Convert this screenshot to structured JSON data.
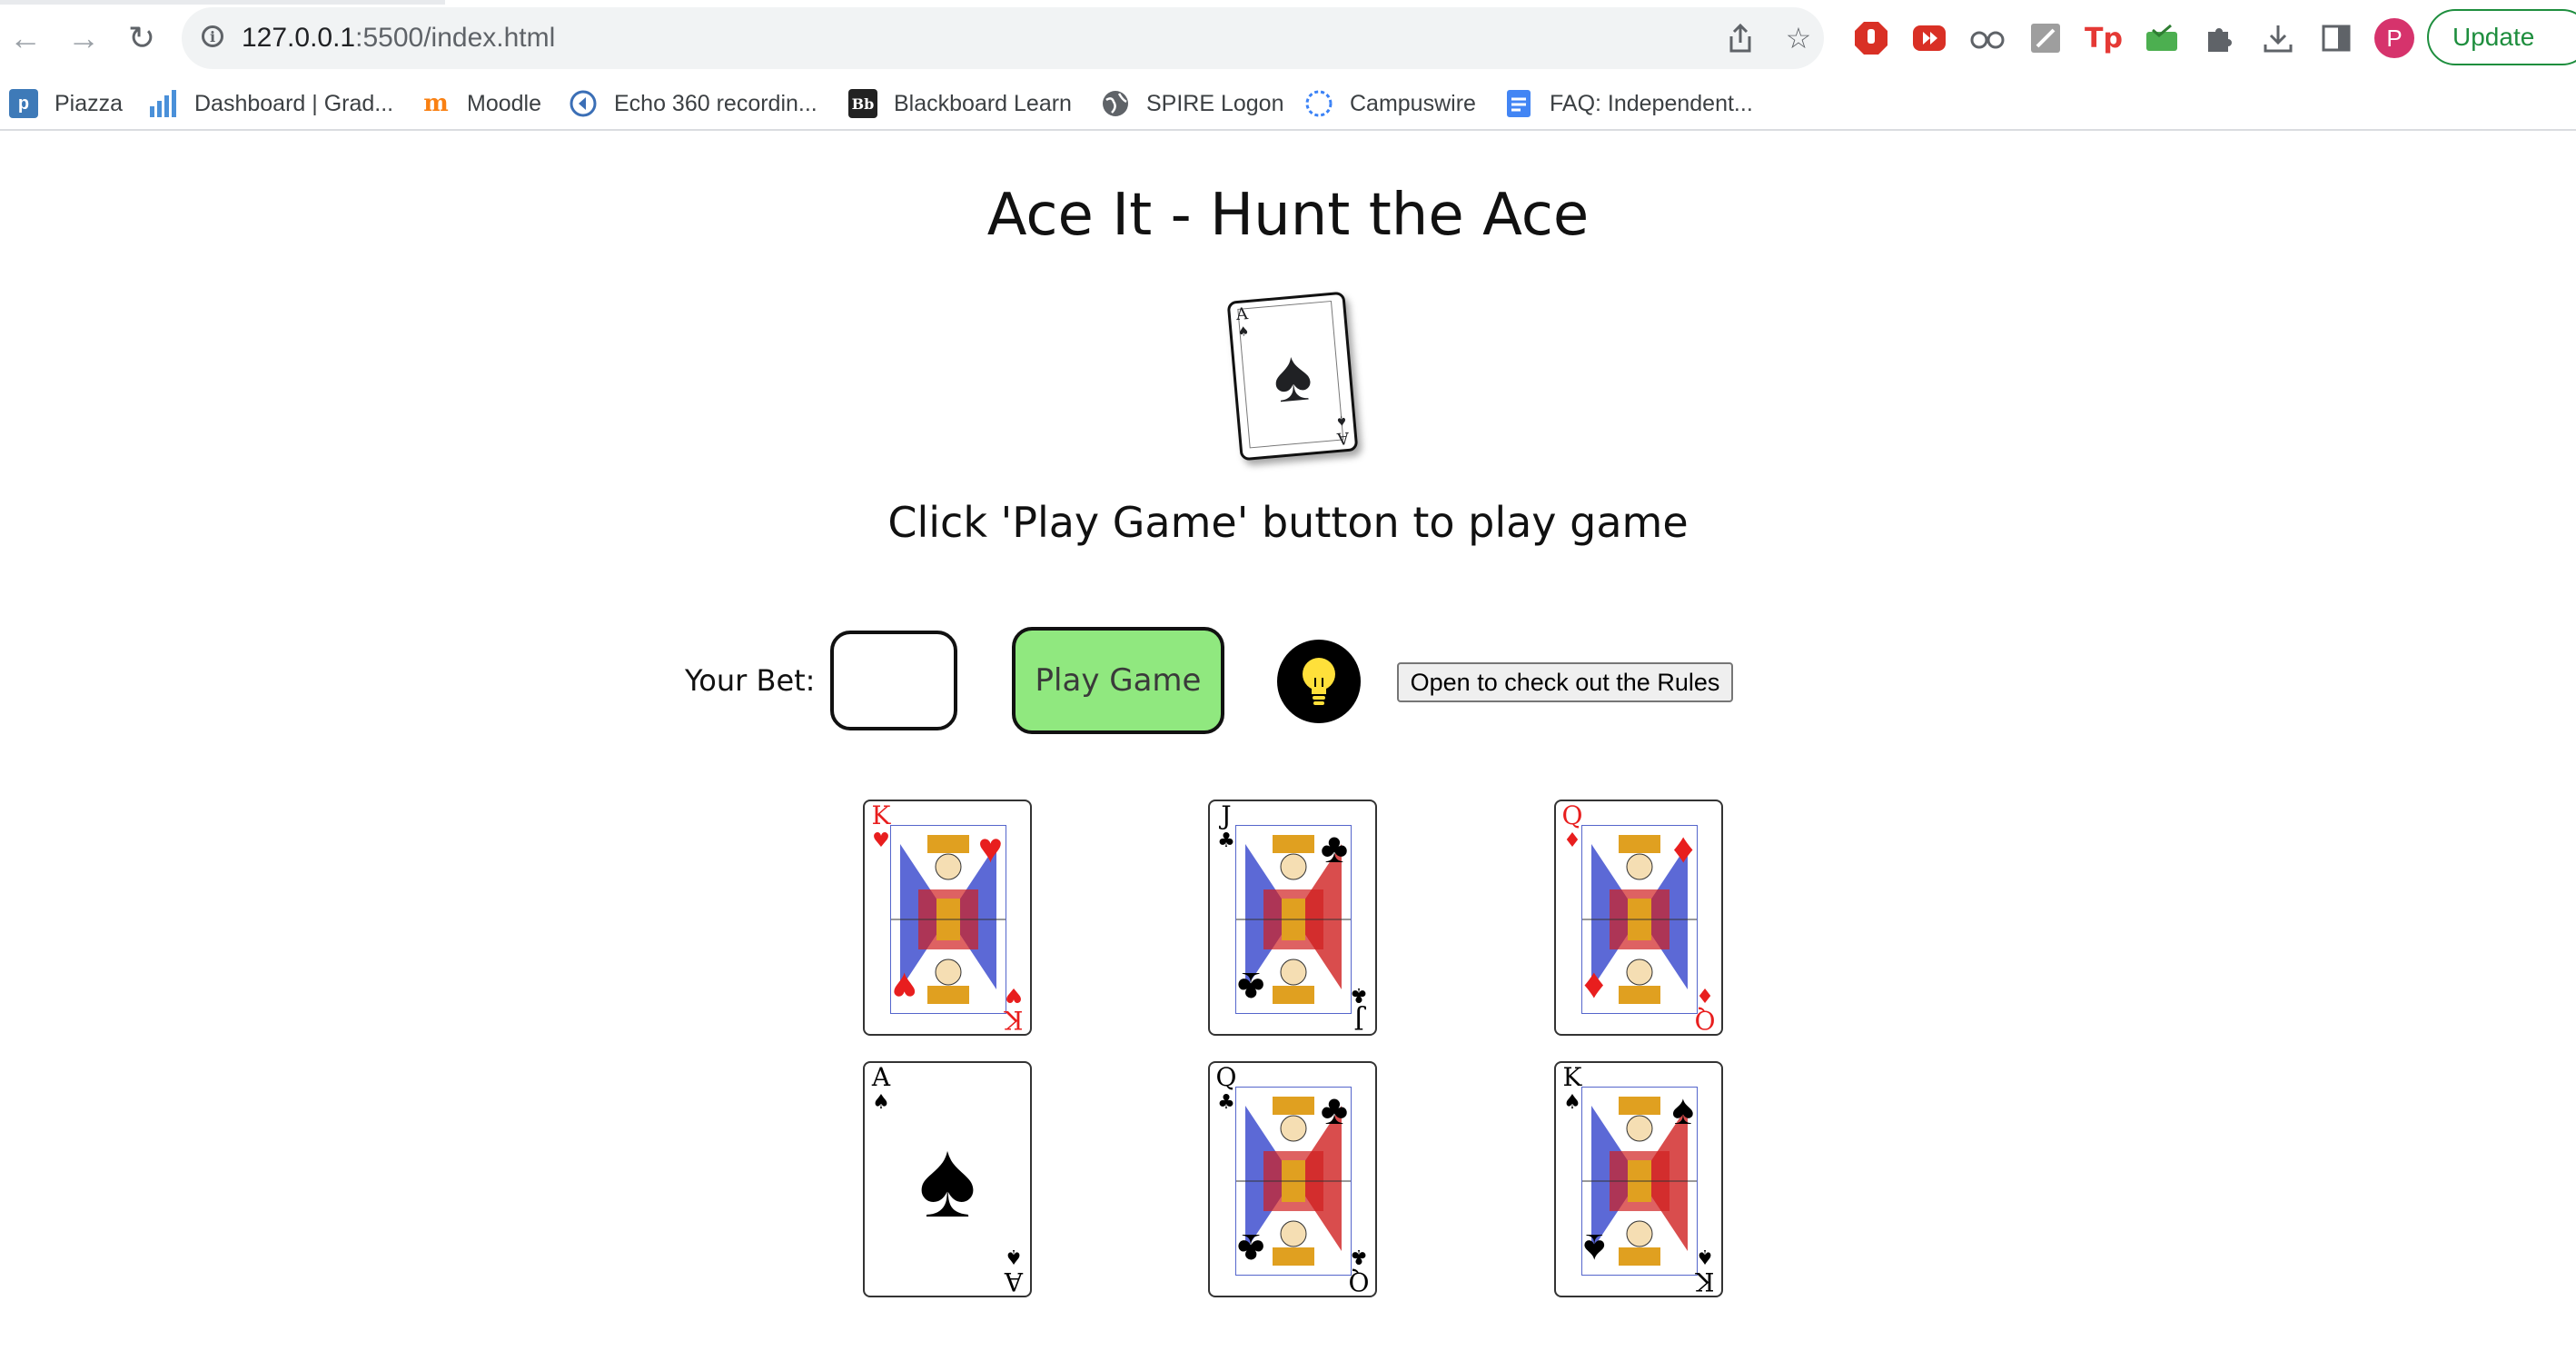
{
  "browser": {
    "url_host": "127.0.0.1",
    "url_path": ":5500/index.html",
    "update_label": "Update",
    "profile_initial": "P",
    "bookmarks": [
      {
        "label": "Piazza",
        "icon": "piazza-icon"
      },
      {
        "label": "Dashboard | Grad...",
        "icon": "bar-chart-icon"
      },
      {
        "label": "Moodle",
        "icon": "moodle-icon"
      },
      {
        "label": "Echo 360 recordin...",
        "icon": "echo360-icon"
      },
      {
        "label": "Blackboard Learn",
        "icon": "blackboard-icon"
      },
      {
        "label": "SPIRE Logon",
        "icon": "globe-icon"
      },
      {
        "label": "Campuswire",
        "icon": "campuswire-icon"
      },
      {
        "label": "FAQ: Independent...",
        "icon": "google-docs-icon"
      }
    ]
  },
  "game": {
    "title": "Ace It - Hunt the Ace",
    "instructions": "Click 'Play Game' button to play game",
    "bet_label": "Your Bet:",
    "bet_value": "",
    "play_label": "Play Game",
    "rules_label": "Open to check out the Rules",
    "hero_card": {
      "rank": "A",
      "suit": "♠"
    },
    "cards": [
      {
        "rank": "K",
        "suit": "♥",
        "color": "#e81e1e",
        "name": "king-of-hearts"
      },
      {
        "rank": "J",
        "suit": "♣",
        "color": "#000000",
        "name": "jack-of-clubs"
      },
      {
        "rank": "Q",
        "suit": "♦",
        "color": "#e81e1e",
        "name": "queen-of-diamonds"
      },
      {
        "rank": "A",
        "suit": "♠",
        "color": "#000000",
        "name": "ace-of-spades"
      },
      {
        "rank": "Q",
        "suit": "♣",
        "color": "#000000",
        "name": "queen-of-clubs"
      },
      {
        "rank": "K",
        "suit": "♠",
        "color": "#000000",
        "name": "king-of-spades"
      }
    ]
  }
}
